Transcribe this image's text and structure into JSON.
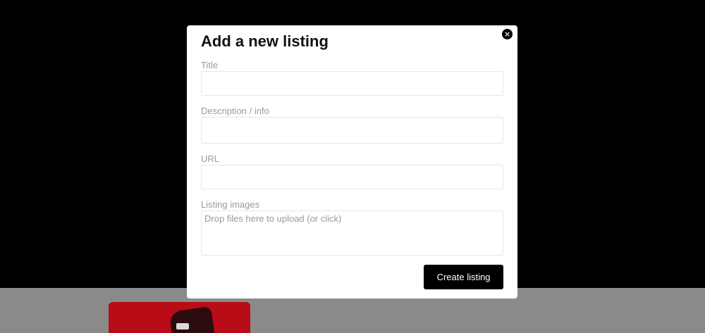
{
  "modal": {
    "title": "Add a new listing",
    "close_icon": "close-icon",
    "fields": {
      "title": {
        "label": "Title",
        "value": ""
      },
      "description": {
        "label": "Description / info",
        "value": ""
      },
      "url": {
        "label": "URL",
        "value": ""
      },
      "images": {
        "label": "Listing images",
        "dropzone_text": "Drop files here to upload (or click)"
      }
    },
    "submit_label": "Create listing"
  },
  "colors": {
    "overlay": "#000000",
    "modal_bg": "#ffffff",
    "button_bg": "#000000",
    "label_text": "#9a9a9a",
    "background_card": "#b80c16"
  }
}
